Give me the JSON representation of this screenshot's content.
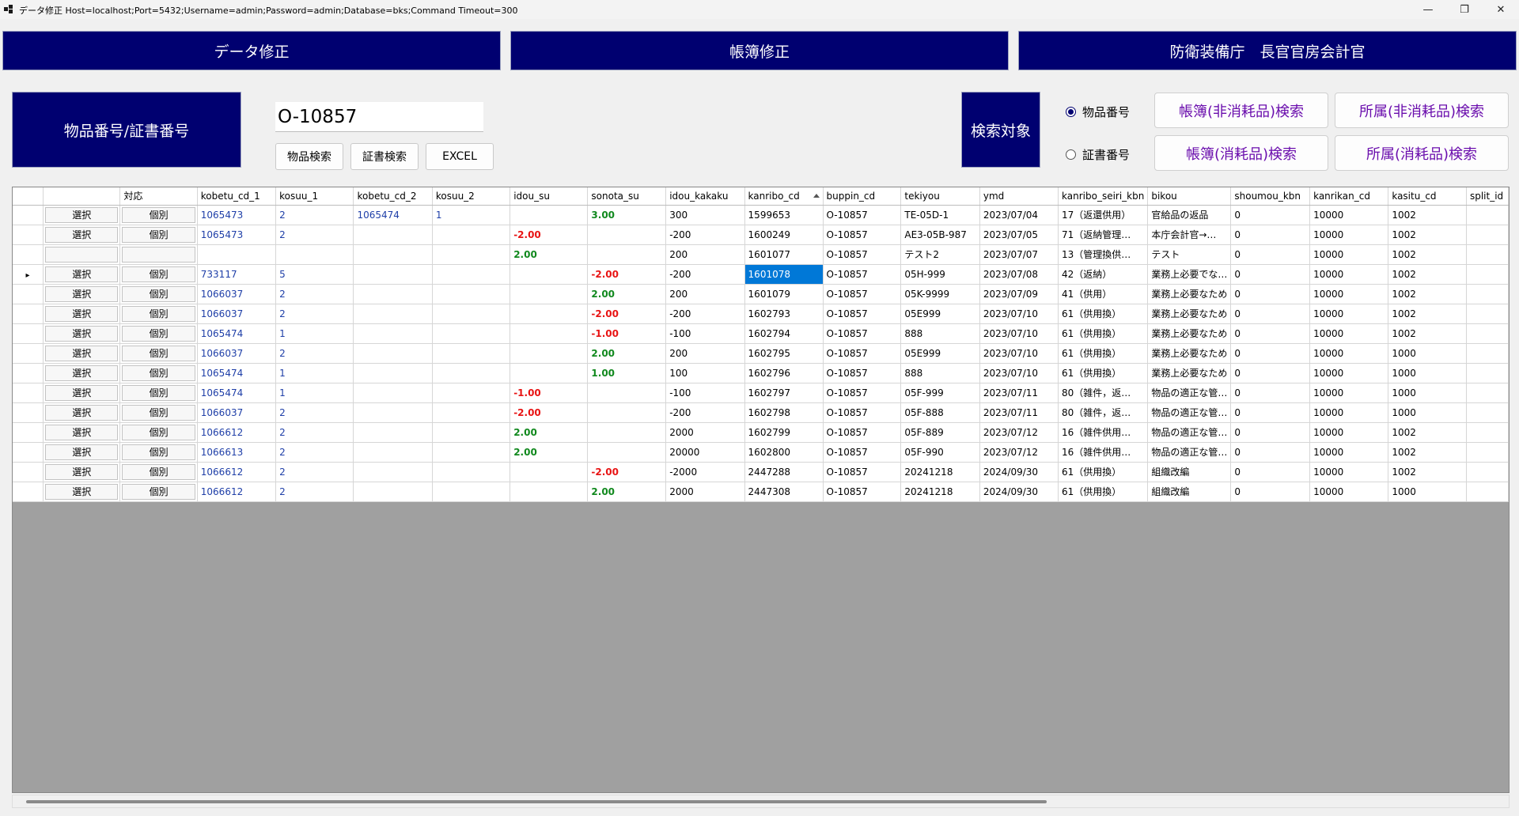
{
  "window": {
    "title": "データ修正 Host=localhost;Port=5432;Username=admin;Password=admin;Database=bks;Command Timeout=300",
    "controls": [
      "—",
      "❐",
      "✕"
    ]
  },
  "top_buttons": [
    "データ修正",
    "帳簿修正",
    "防衛装備庁　長官官房会計官"
  ],
  "search": {
    "label": "物品番号/証書番号",
    "value": "O-10857",
    "buttons": [
      "物品検索",
      "証書検索",
      "EXCEL"
    ]
  },
  "target": {
    "label": "検索対象",
    "radios": [
      {
        "label": "物品番号",
        "checked": true
      },
      {
        "label": "証書番号",
        "checked": false
      }
    ],
    "buttons": [
      "帳簿(非消耗品)検索",
      "所属(非消耗品)検索",
      "帳簿(消耗品)検索",
      "所属(消耗品)検索"
    ]
  },
  "grid": {
    "columns": [
      "",
      "",
      "対応",
      "kobetu_cd_1",
      "kosuu_1",
      "kobetu_cd_2",
      "kosuu_2",
      "idou_su",
      "sonota_su",
      "idou_kakaku",
      "kanribo_cd",
      "buppin_cd",
      "tekiyou",
      "ymd",
      "kanribo_seiri_kbn",
      "bikou",
      "shoumou_kbn",
      "kanrikan_cd",
      "kasitu_cd",
      "split_id"
    ],
    "sorted_column": "kanribo_cd",
    "current_row_marker": "▸",
    "rows": [
      {
        "btn1": "選択",
        "btn2": "個別",
        "kobetu_cd_1": "1065473",
        "kosuu_1": "2",
        "kobetu_cd_2": "1065474",
        "kosuu_2": "1",
        "idou_su": "",
        "sonota_su": "3.00",
        "idou_kakaku": "300",
        "kanribo_cd": "1599653",
        "buppin_cd": "O-10857",
        "tekiyou": "TE-05D-1",
        "ymd": "2023/07/04",
        "kanribo_seiri_kbn": "17（返還供用）",
        "bikou": "官給品の返品",
        "shoumou_kbn": "0",
        "kanrikan_cd": "10000",
        "kasitu_cd": "1002",
        "split_id": ""
      },
      {
        "btn1": "選択",
        "btn2": "個別",
        "kobetu_cd_1": "1065473",
        "kosuu_1": "2",
        "kobetu_cd_2": "",
        "kosuu_2": "",
        "idou_su": "-2.00",
        "sonota_su": "",
        "idou_kakaku": "-200",
        "kanribo_cd": "1600249",
        "buppin_cd": "O-10857",
        "tekiyou": "AE3-05B-987",
        "ymd": "2023/07/05",
        "kanribo_seiri_kbn": "71（返納管理…",
        "bikou": "本庁会計官→…",
        "shoumou_kbn": "0",
        "kanrikan_cd": "10000",
        "kasitu_cd": "1002",
        "split_id": ""
      },
      {
        "btn1": "",
        "btn2": "",
        "kobetu_cd_1": "",
        "kosuu_1": "",
        "kobetu_cd_2": "",
        "kosuu_2": "",
        "idou_su": "2.00",
        "sonota_su": "",
        "idou_kakaku": "200",
        "kanribo_cd": "1601077",
        "buppin_cd": "O-10857",
        "tekiyou": "テスト2",
        "ymd": "2023/07/07",
        "kanribo_seiri_kbn": "13（管理換供…",
        "bikou": "テスト",
        "shoumou_kbn": "0",
        "kanrikan_cd": "10000",
        "kasitu_cd": "1002",
        "split_id": ""
      },
      {
        "btn1": "選択",
        "btn2": "個別",
        "kobetu_cd_1": "733117",
        "kosuu_1": "5",
        "kobetu_cd_2": "",
        "kosuu_2": "",
        "idou_su": "",
        "sonota_su": "-2.00",
        "idou_kakaku": "-200",
        "kanribo_cd": "1601078",
        "buppin_cd": "O-10857",
        "tekiyou": "05H-999",
        "ymd": "2023/07/08",
        "kanribo_seiri_kbn": "42（返納）",
        "bikou": "業務上必要でな…",
        "shoumou_kbn": "0",
        "kanrikan_cd": "10000",
        "kasitu_cd": "1002",
        "split_id": ""
      },
      {
        "btn1": "選択",
        "btn2": "個別",
        "kobetu_cd_1": "1066037",
        "kosuu_1": "2",
        "kobetu_cd_2": "",
        "kosuu_2": "",
        "idou_su": "",
        "sonota_su": "2.00",
        "idou_kakaku": "200",
        "kanribo_cd": "1601079",
        "buppin_cd": "O-10857",
        "tekiyou": "05K-9999",
        "ymd": "2023/07/09",
        "kanribo_seiri_kbn": "41（供用）",
        "bikou": "業務上必要なため",
        "shoumou_kbn": "0",
        "kanrikan_cd": "10000",
        "kasitu_cd": "1002",
        "split_id": ""
      },
      {
        "btn1": "選択",
        "btn2": "個別",
        "kobetu_cd_1": "1066037",
        "kosuu_1": "2",
        "kobetu_cd_2": "",
        "kosuu_2": "",
        "idou_su": "",
        "sonota_su": "-2.00",
        "idou_kakaku": "-200",
        "kanribo_cd": "1602793",
        "buppin_cd": "O-10857",
        "tekiyou": "05E999",
        "ymd": "2023/07/10",
        "kanribo_seiri_kbn": "61（供用換）",
        "bikou": "業務上必要なため",
        "shoumou_kbn": "0",
        "kanrikan_cd": "10000",
        "kasitu_cd": "1002",
        "split_id": ""
      },
      {
        "btn1": "選択",
        "btn2": "個別",
        "kobetu_cd_1": "1065474",
        "kosuu_1": "1",
        "kobetu_cd_2": "",
        "kosuu_2": "",
        "idou_su": "",
        "sonota_su": "-1.00",
        "idou_kakaku": "-100",
        "kanribo_cd": "1602794",
        "buppin_cd": "O-10857",
        "tekiyou": "888",
        "ymd": "2023/07/10",
        "kanribo_seiri_kbn": "61（供用換）",
        "bikou": "業務上必要なため",
        "shoumou_kbn": "0",
        "kanrikan_cd": "10000",
        "kasitu_cd": "1002",
        "split_id": ""
      },
      {
        "btn1": "選択",
        "btn2": "個別",
        "kobetu_cd_1": "1066037",
        "kosuu_1": "2",
        "kobetu_cd_2": "",
        "kosuu_2": "",
        "idou_su": "",
        "sonota_su": "2.00",
        "idou_kakaku": "200",
        "kanribo_cd": "1602795",
        "buppin_cd": "O-10857",
        "tekiyou": "05E999",
        "ymd": "2023/07/10",
        "kanribo_seiri_kbn": "61（供用換）",
        "bikou": "業務上必要なため",
        "shoumou_kbn": "0",
        "kanrikan_cd": "10000",
        "kasitu_cd": "1000",
        "split_id": ""
      },
      {
        "btn1": "選択",
        "btn2": "個別",
        "kobetu_cd_1": "1065474",
        "kosuu_1": "1",
        "kobetu_cd_2": "",
        "kosuu_2": "",
        "idou_su": "",
        "sonota_su": "1.00",
        "idou_kakaku": "100",
        "kanribo_cd": "1602796",
        "buppin_cd": "O-10857",
        "tekiyou": "888",
        "ymd": "2023/07/10",
        "kanribo_seiri_kbn": "61（供用換）",
        "bikou": "業務上必要なため",
        "shoumou_kbn": "0",
        "kanrikan_cd": "10000",
        "kasitu_cd": "1000",
        "split_id": ""
      },
      {
        "btn1": "選択",
        "btn2": "個別",
        "kobetu_cd_1": "1065474",
        "kosuu_1": "1",
        "kobetu_cd_2": "",
        "kosuu_2": "",
        "idou_su": "-1.00",
        "sonota_su": "",
        "idou_kakaku": "-100",
        "kanribo_cd": "1602797",
        "buppin_cd": "O-10857",
        "tekiyou": "05F-999",
        "ymd": "2023/07/11",
        "kanribo_seiri_kbn": "80（雑件，返…",
        "bikou": "物品の適正な管…",
        "shoumou_kbn": "0",
        "kanrikan_cd": "10000",
        "kasitu_cd": "1000",
        "split_id": ""
      },
      {
        "btn1": "選択",
        "btn2": "個別",
        "kobetu_cd_1": "1066037",
        "kosuu_1": "2",
        "kobetu_cd_2": "",
        "kosuu_2": "",
        "idou_su": "-2.00",
        "sonota_su": "",
        "idou_kakaku": "-200",
        "kanribo_cd": "1602798",
        "buppin_cd": "O-10857",
        "tekiyou": "05F-888",
        "ymd": "2023/07/11",
        "kanribo_seiri_kbn": "80（雑件，返…",
        "bikou": "物品の適正な管…",
        "shoumou_kbn": "0",
        "kanrikan_cd": "10000",
        "kasitu_cd": "1000",
        "split_id": ""
      },
      {
        "btn1": "選択",
        "btn2": "個別",
        "kobetu_cd_1": "1066612",
        "kosuu_1": "2",
        "kobetu_cd_2": "",
        "kosuu_2": "",
        "idou_su": "2.00",
        "sonota_su": "",
        "idou_kakaku": "2000",
        "kanribo_cd": "1602799",
        "buppin_cd": "O-10857",
        "tekiyou": "05F-889",
        "ymd": "2023/07/12",
        "kanribo_seiri_kbn": "16（雑件供用…",
        "bikou": "物品の適正な管…",
        "shoumou_kbn": "0",
        "kanrikan_cd": "10000",
        "kasitu_cd": "1002",
        "split_id": ""
      },
      {
        "btn1": "選択",
        "btn2": "個別",
        "kobetu_cd_1": "1066613",
        "kosuu_1": "2",
        "kobetu_cd_2": "",
        "kosuu_2": "",
        "idou_su": "2.00",
        "sonota_su": "",
        "idou_kakaku": "20000",
        "kanribo_cd": "1602800",
        "buppin_cd": "O-10857",
        "tekiyou": "05F-990",
        "ymd": "2023/07/12",
        "kanribo_seiri_kbn": "16（雑件供用…",
        "bikou": "物品の適正な管…",
        "shoumou_kbn": "0",
        "kanrikan_cd": "10000",
        "kasitu_cd": "1002",
        "split_id": ""
      },
      {
        "btn1": "選択",
        "btn2": "個別",
        "kobetu_cd_1": "1066612",
        "kosuu_1": "2",
        "kobetu_cd_2": "",
        "kosuu_2": "",
        "idou_su": "",
        "sonota_su": "-2.00",
        "idou_kakaku": "-2000",
        "kanribo_cd": "2447288",
        "buppin_cd": "O-10857",
        "tekiyou": "20241218",
        "ymd": "2024/09/30",
        "kanribo_seiri_kbn": "61（供用換）",
        "bikou": "組織改編",
        "shoumou_kbn": "0",
        "kanrikan_cd": "10000",
        "kasitu_cd": "1002",
        "split_id": ""
      },
      {
        "btn1": "選択",
        "btn2": "個別",
        "kobetu_cd_1": "1066612",
        "kosuu_1": "2",
        "kobetu_cd_2": "",
        "kosuu_2": "",
        "idou_su": "",
        "sonota_su": "2.00",
        "idou_kakaku": "2000",
        "kanribo_cd": "2447308",
        "buppin_cd": "O-10857",
        "tekiyou": "20241218",
        "ymd": "2024/09/30",
        "kanribo_seiri_kbn": "61（供用換）",
        "bikou": "組織改編",
        "shoumou_kbn": "0",
        "kanrikan_cd": "10000",
        "kasitu_cd": "1000",
        "split_id": ""
      }
    ],
    "current_row_index": 3,
    "selected_cell": {
      "row": 3,
      "column": "kanribo_cd"
    }
  },
  "colors": {
    "navy": "#000070",
    "purple_text": "#6a0dad",
    "negative": "#e81414",
    "positive": "#11891e",
    "link": "#1f3fa8",
    "selection": "#0078d7"
  }
}
